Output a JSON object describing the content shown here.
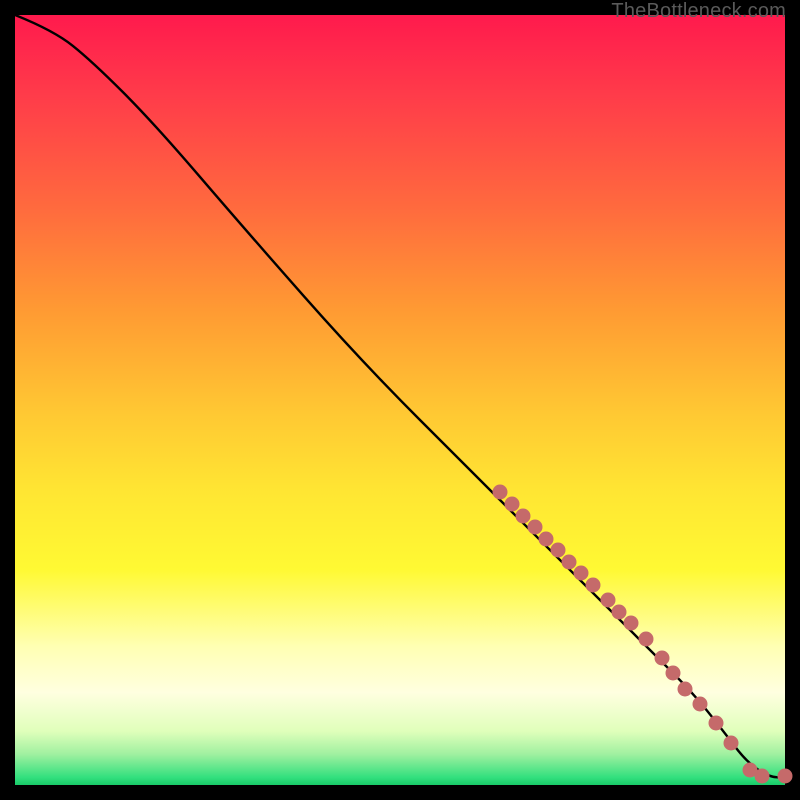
{
  "watermark": "TheBottleneck.com",
  "chart_data": {
    "type": "line",
    "title": "",
    "xlabel": "",
    "ylabel": "",
    "xlim": [
      0,
      100
    ],
    "ylim": [
      0,
      100
    ],
    "curve": [
      {
        "x": 0,
        "y": 100
      },
      {
        "x": 5,
        "y": 98
      },
      {
        "x": 10,
        "y": 94
      },
      {
        "x": 18,
        "y": 86
      },
      {
        "x": 30,
        "y": 72
      },
      {
        "x": 45,
        "y": 55
      },
      {
        "x": 60,
        "y": 40
      },
      {
        "x": 72,
        "y": 28
      },
      {
        "x": 82,
        "y": 18
      },
      {
        "x": 88,
        "y": 12
      },
      {
        "x": 92,
        "y": 7
      },
      {
        "x": 95,
        "y": 3
      },
      {
        "x": 98,
        "y": 1
      },
      {
        "x": 100,
        "y": 1
      }
    ],
    "points": [
      {
        "x": 63,
        "y": 38
      },
      {
        "x": 64.5,
        "y": 36.5
      },
      {
        "x": 66,
        "y": 35
      },
      {
        "x": 67.5,
        "y": 33.5
      },
      {
        "x": 69,
        "y": 32
      },
      {
        "x": 70.5,
        "y": 30.5
      },
      {
        "x": 72,
        "y": 29
      },
      {
        "x": 73.5,
        "y": 27.5
      },
      {
        "x": 75,
        "y": 26
      },
      {
        "x": 77,
        "y": 24
      },
      {
        "x": 78.5,
        "y": 22.5
      },
      {
        "x": 80,
        "y": 21
      },
      {
        "x": 82,
        "y": 19
      },
      {
        "x": 84,
        "y": 16.5
      },
      {
        "x": 85.5,
        "y": 14.5
      },
      {
        "x": 87,
        "y": 12.5
      },
      {
        "x": 89,
        "y": 10.5
      },
      {
        "x": 91,
        "y": 8
      },
      {
        "x": 93,
        "y": 5.5
      },
      {
        "x": 95.5,
        "y": 2
      },
      {
        "x": 97,
        "y": 1.2
      },
      {
        "x": 100,
        "y": 1.2
      }
    ],
    "point_radius": 7.5
  }
}
